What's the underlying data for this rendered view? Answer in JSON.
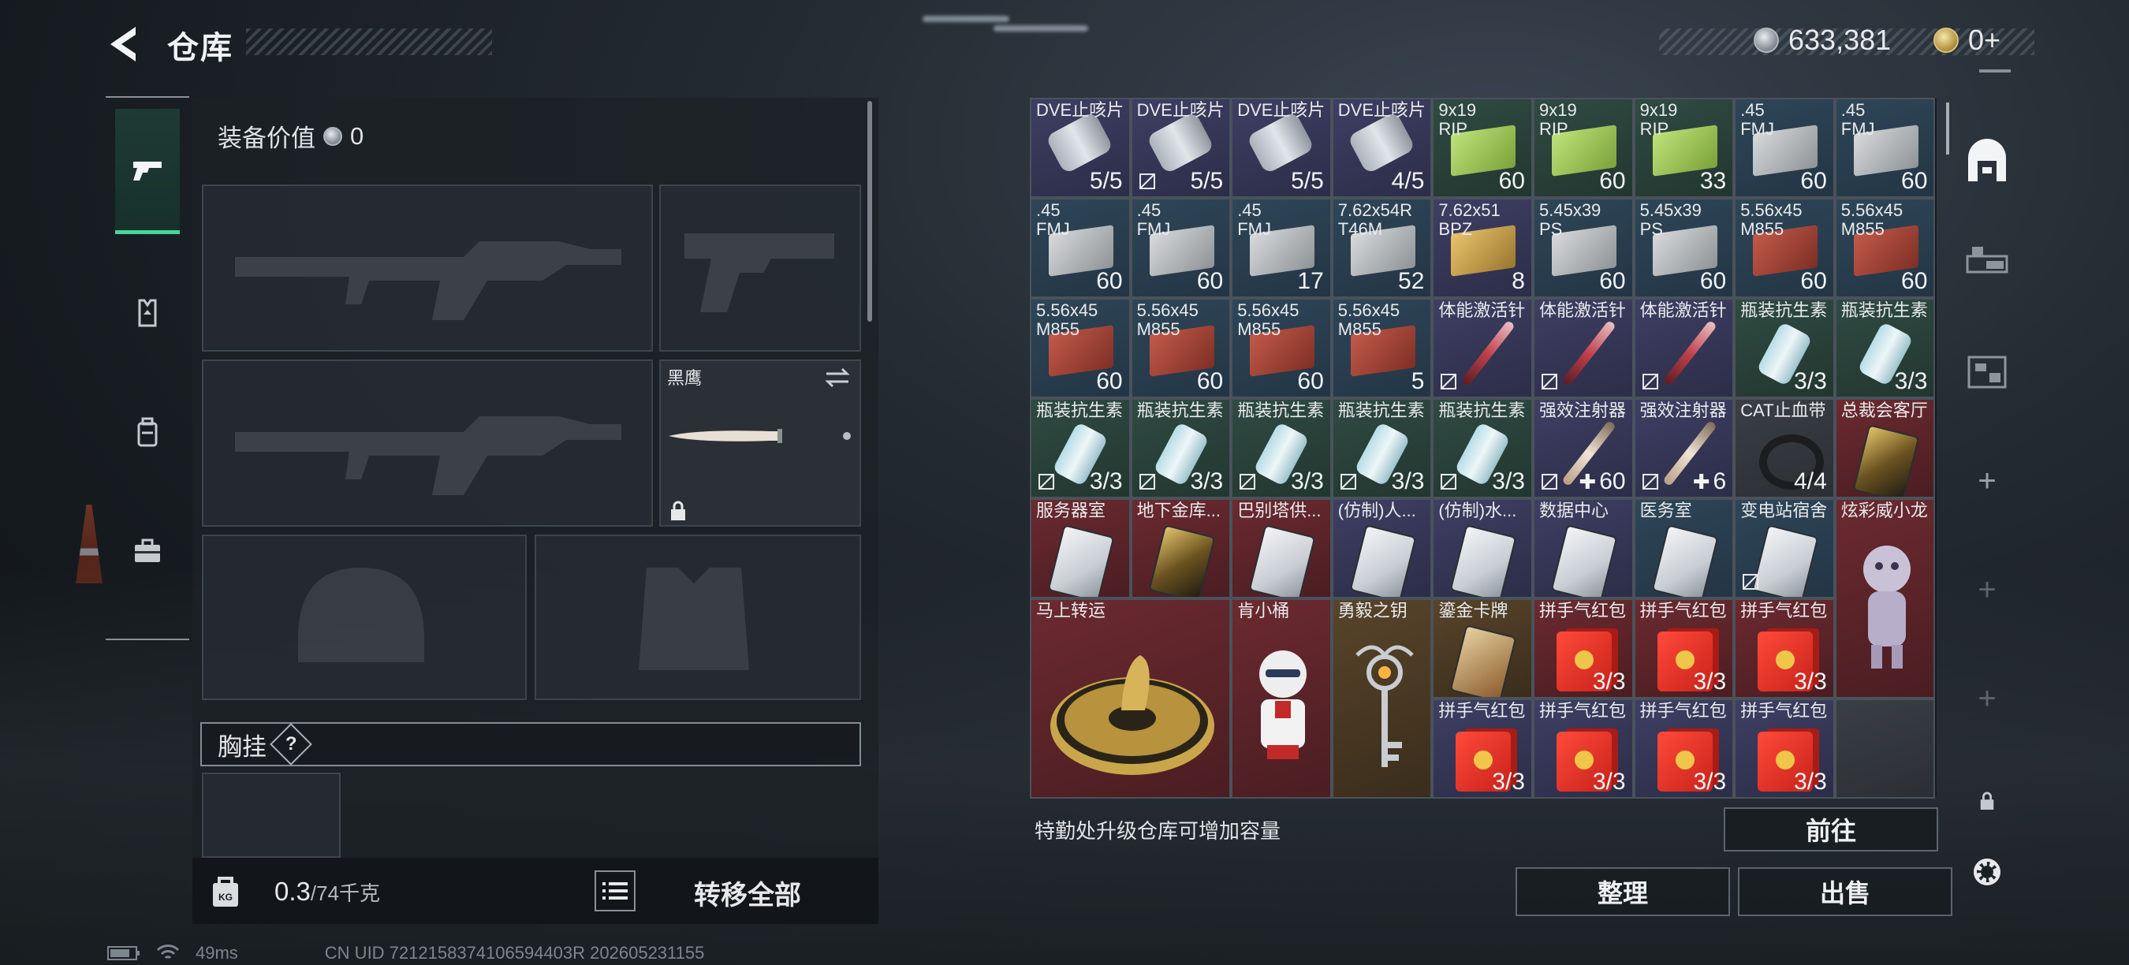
{
  "header": {
    "title": "仓库",
    "currency_silver": "633,381",
    "currency_gold": "0+"
  },
  "left_nav": {
    "tabs": [
      {
        "name": "weapon-tab",
        "icon": "pistol-icon",
        "active": true
      },
      {
        "name": "gear-tab",
        "icon": "vest-icon",
        "active": false
      },
      {
        "name": "backpack-tab",
        "icon": "backpack-icon",
        "active": false
      },
      {
        "name": "case-tab",
        "icon": "briefcase-icon",
        "active": false
      }
    ]
  },
  "equipment": {
    "value_label": "装备价值",
    "value": "0",
    "melee_name": "黑鹰",
    "chest_rig_label": "胸挂",
    "chest_rig_help": "?",
    "weight": "0.3",
    "weight_max": "/74千克",
    "transfer_all": "转移全部"
  },
  "stash": {
    "cells": [
      {
        "name": "DVE止咳片",
        "count": "5/5",
        "color": "purple",
        "icon": "inhaler",
        "noicon": false
      },
      {
        "name": "DVE止咳片",
        "count": "5/5",
        "color": "purple",
        "icon": "inhaler",
        "noicon": true
      },
      {
        "name": "DVE止咳片",
        "count": "5/5",
        "color": "purple",
        "icon": "inhaler",
        "noicon": false
      },
      {
        "name": "DVE止咳片",
        "count": "4/5",
        "color": "purple",
        "icon": "inhaler",
        "noicon": false
      },
      {
        "name": "9x19\nRIP",
        "count": "60",
        "color": "green",
        "icon": "ammo-green",
        "noicon": false
      },
      {
        "name": "9x19\nRIP",
        "count": "60",
        "color": "green",
        "icon": "ammo-green",
        "noicon": false
      },
      {
        "name": "9x19\nRIP",
        "count": "33",
        "color": "green",
        "icon": "ammo-green",
        "noicon": false
      },
      {
        "name": ".45\nFMJ",
        "count": "60",
        "color": "blue",
        "icon": "ammo-gray",
        "noicon": false
      },
      {
        "name": ".45\nFMJ",
        "count": "60",
        "color": "blue",
        "icon": "ammo-gray",
        "noicon": false
      },
      {
        "name": ".45\nFMJ",
        "count": "60",
        "color": "blue",
        "icon": "ammo-gray",
        "noicon": false
      },
      {
        "name": ".45\nFMJ",
        "count": "60",
        "color": "blue",
        "icon": "ammo-gray",
        "noicon": false
      },
      {
        "name": ".45\nFMJ",
        "count": "17",
        "color": "blue",
        "icon": "ammo-gray",
        "noicon": false
      },
      {
        "name": "7.62x54R\nT46M",
        "count": "52",
        "color": "blue",
        "icon": "ammo-gray",
        "noicon": false
      },
      {
        "name": "7.62x51\nBPZ",
        "count": "8",
        "color": "purple",
        "icon": "ammo-gold",
        "noicon": false
      },
      {
        "name": "5.45x39\nPS",
        "count": "60",
        "color": "blue",
        "icon": "ammo-gray",
        "noicon": false
      },
      {
        "name": "5.45x39\nPS",
        "count": "60",
        "color": "blue",
        "icon": "ammo-gray",
        "noicon": false
      },
      {
        "name": "5.56x45\nM855",
        "count": "60",
        "color": "blue",
        "icon": "ammo-red",
        "noicon": false
      },
      {
        "name": "5.56x45\nM855",
        "count": "60",
        "color": "blue",
        "icon": "ammo-red",
        "noicon": false
      },
      {
        "name": "5.56x45\nM855",
        "count": "60",
        "color": "blue",
        "icon": "ammo-red",
        "noicon": false
      },
      {
        "name": "5.56x45\nM855",
        "count": "60",
        "color": "blue",
        "icon": "ammo-red",
        "noicon": false
      },
      {
        "name": "5.56x45\nM855",
        "count": "60",
        "color": "blue",
        "icon": "ammo-red",
        "noicon": false
      },
      {
        "name": "5.56x45\nM855",
        "count": "5",
        "color": "blue",
        "icon": "ammo-red",
        "noicon": false
      },
      {
        "name": "体能激活针",
        "count": "",
        "color": "purple",
        "icon": "syringe",
        "noicon": true
      },
      {
        "name": "体能激活针",
        "count": "",
        "color": "purple",
        "icon": "syringe",
        "noicon": true
      },
      {
        "name": "体能激活针",
        "count": "",
        "color": "purple",
        "icon": "syringe",
        "noicon": true
      },
      {
        "name": "瓶装抗生素",
        "count": "3/3",
        "color": "green",
        "icon": "bottle",
        "noicon": false
      },
      {
        "name": "瓶装抗生素",
        "count": "3/3",
        "color": "green",
        "icon": "bottle",
        "noicon": false
      },
      {
        "name": "瓶装抗生素",
        "count": "3/3",
        "color": "green",
        "icon": "bottle",
        "noicon": true
      },
      {
        "name": "瓶装抗生素",
        "count": "3/3",
        "color": "green",
        "icon": "bottle",
        "noicon": true
      },
      {
        "name": "瓶装抗生素",
        "count": "3/3",
        "color": "green",
        "icon": "bottle",
        "noicon": true
      },
      {
        "name": "瓶装抗生素",
        "count": "3/3",
        "color": "green",
        "icon": "bottle",
        "noicon": true
      },
      {
        "name": "瓶装抗生素",
        "count": "3/3",
        "color": "green",
        "icon": "bottle",
        "noicon": true
      },
      {
        "name": "强效注射器",
        "count": "60",
        "color": "purple",
        "icon": "syringe-beige",
        "noicon": true,
        "plus": true
      },
      {
        "name": "强效注射器",
        "count": "6",
        "color": "purple",
        "icon": "syringe-beige",
        "noicon": true,
        "plus": true
      },
      {
        "name": "CAT止血带",
        "count": "4/4",
        "color": "gray",
        "icon": "tourniquet",
        "noicon": false
      },
      {
        "name": "总裁会客厅",
        "count": "",
        "color": "red",
        "icon": "card-gold",
        "noicon": false
      },
      {
        "name": "服务器室",
        "count": "",
        "color": "red",
        "icon": "card",
        "noicon": false
      },
      {
        "name": "地下金库...",
        "count": "",
        "color": "red",
        "icon": "card-gold",
        "noicon": false
      },
      {
        "name": "巴别塔供...",
        "count": "",
        "color": "red",
        "icon": "card",
        "noicon": false
      },
      {
        "name": "(仿制)人...",
        "count": "",
        "color": "purple",
        "icon": "card",
        "noicon": false
      },
      {
        "name": "(仿制)水...",
        "count": "",
        "color": "purple",
        "icon": "card",
        "noicon": false
      },
      {
        "name": "数据中心",
        "count": "",
        "color": "purple",
        "icon": "card",
        "noicon": false
      },
      {
        "name": "医务室",
        "count": "",
        "color": "blue",
        "icon": "card",
        "noicon": false
      },
      {
        "name": "变电站宿舍",
        "count": "",
        "color": "blue",
        "icon": "card",
        "noicon": true
      }
    ],
    "large_items": [
      {
        "name": "炫彩威小龙",
        "icon": "dragon-figure"
      },
      {
        "name": "马上转运",
        "icon": "fortune-wheel"
      },
      {
        "name": "肯小桶",
        "icon": "colonel-figure"
      },
      {
        "name": "勇毅之钥",
        "icon": "ornate-key"
      }
    ],
    "small_extra": [
      {
        "name": "鎏金卡牌",
        "count": "",
        "icon": "gold-cards"
      },
      {
        "name": "拼手气红包",
        "count": "3/3",
        "icon": "red-envelope"
      },
      {
        "name": "拼手气红包",
        "count": "3/3",
        "icon": "red-envelope"
      },
      {
        "name": "拼手气红包",
        "count": "3/3",
        "icon": "red-envelope"
      },
      {
        "name": "拼手气红包",
        "count": "3/3",
        "icon": "red-envelope"
      },
      {
        "name": "拼手气红包",
        "count": "3/3",
        "icon": "red-envelope"
      },
      {
        "name": "拼手气红包",
        "count": "3/3",
        "icon": "red-envelope"
      },
      {
        "name": "拼手气红包",
        "count": "3/3",
        "icon": "red-envelope"
      }
    ],
    "capacity_note": "特勤处升级仓库可增加容量",
    "goto_label": "前往",
    "sort_label": "整理",
    "sell_label": "出售"
  },
  "status_bar": {
    "ping": "49ms",
    "uid": "CN UID 7212158374106594403R 202605231155"
  },
  "colors": {
    "accent_green": "#43d49a",
    "panel_bg": "#1c2126"
  }
}
